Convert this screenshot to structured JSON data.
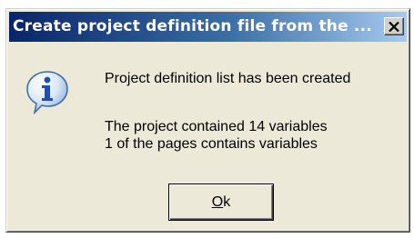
{
  "dialog": {
    "title": "Create project definition file from the ...",
    "close_label": "X",
    "icon": "info-icon",
    "message_line1": "Project definition list has been created",
    "message_line2": "The project contained 14 variables",
    "message_line3": "1 of the pages contains variables",
    "ok_mnemonic": "O",
    "ok_rest": "k"
  }
}
